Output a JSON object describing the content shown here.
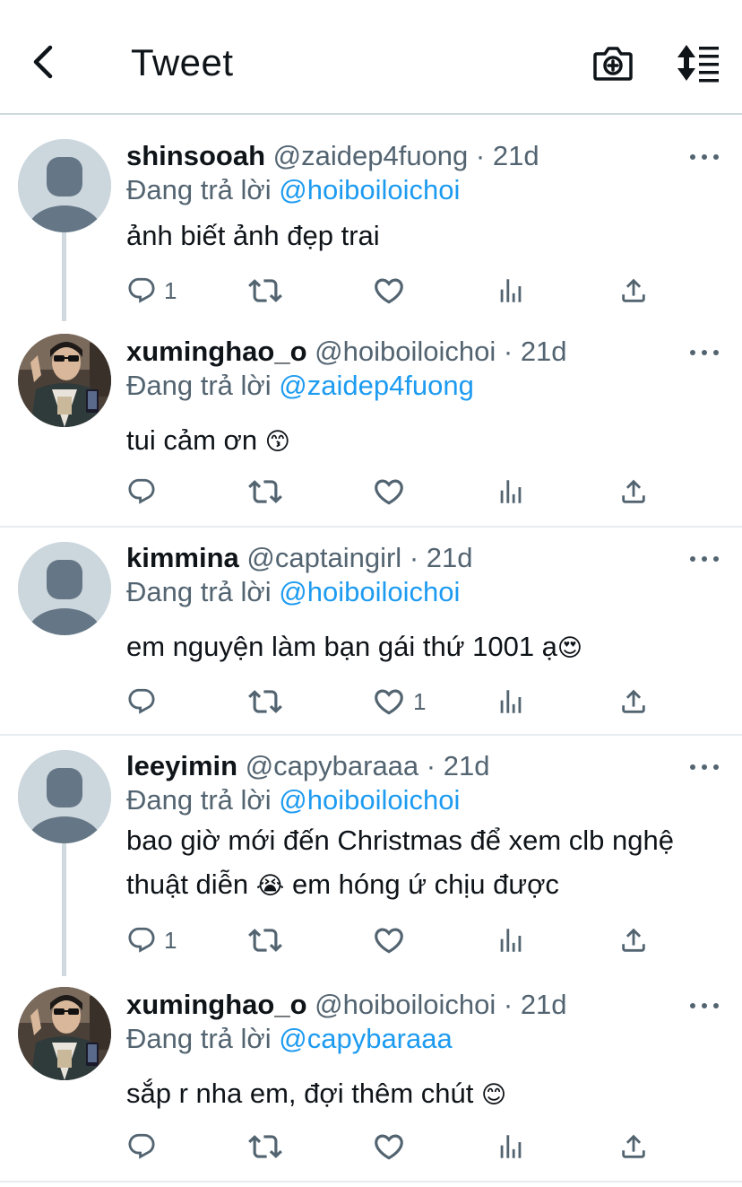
{
  "header": {
    "title": "Tweet",
    "back_icon": "chevron-left-icon",
    "camera_icon": "camera-plus-icon",
    "sort_icon": "sort-icon"
  },
  "tweets": [
    {
      "name": "shinsooah",
      "handle": "@zaidep4fuong",
      "dot": "·",
      "time": "21d",
      "reply_prefix": "Đang trả lời",
      "reply_to": "@hoiboiloichoi",
      "text": "ảnh biết ảnh đẹp trai",
      "emoji": "",
      "reply_count": "1",
      "like_count": "",
      "avatar": "default-avatar"
    },
    {
      "name": "xuminghao_o",
      "handle": "@hoiboiloichoi",
      "dot": "·",
      "time": "21d",
      "reply_prefix": "Đang trả lời",
      "reply_to": "@zaidep4fuong",
      "text": "tui cảm ơn",
      "emoji": "😙",
      "reply_count": "",
      "like_count": "",
      "avatar": "photo-avatar"
    },
    {
      "name": "kimmina",
      "handle": "@captaingirl",
      "dot": "·",
      "time": "21d",
      "reply_prefix": "Đang trả lời",
      "reply_to": "@hoiboiloichoi",
      "text": "em nguyện làm bạn gái thứ 1001 ạ",
      "emoji": "😍",
      "reply_count": "",
      "like_count": "1",
      "avatar": "default-avatar"
    },
    {
      "name": "leeyimin",
      "handle": "@capybaraaa",
      "dot": "·",
      "time": "21d",
      "reply_prefix": "Đang trả lời",
      "reply_to": "@hoiboiloichoi",
      "text_line1": "bao giờ mới đến Christmas để xem clb nghệ",
      "text_line2_a": "thuật diễn",
      "emoji": "😭",
      "text_line2_b": "em hóng ứ chịu được",
      "reply_count": "1",
      "like_count": "",
      "avatar": "default-avatar"
    },
    {
      "name": "xuminghao_o",
      "handle": "@hoiboiloichoi",
      "dot": "·",
      "time": "21d",
      "reply_prefix": "Đang trả lời",
      "reply_to": "@capybaraaa",
      "text": "sắp r nha em, đợi thêm chút",
      "emoji": "😊",
      "reply_count": "",
      "like_count": "",
      "avatar": "photo-avatar"
    }
  ],
  "action_icons": [
    "reply-icon",
    "retweet-icon",
    "like-icon",
    "stats-icon",
    "share-icon"
  ],
  "colors": {
    "accent": "#1d9bf0",
    "secondary_text": "#536471",
    "divider": "#cfd9de",
    "avatar_placeholder": "#ccd6dd"
  }
}
